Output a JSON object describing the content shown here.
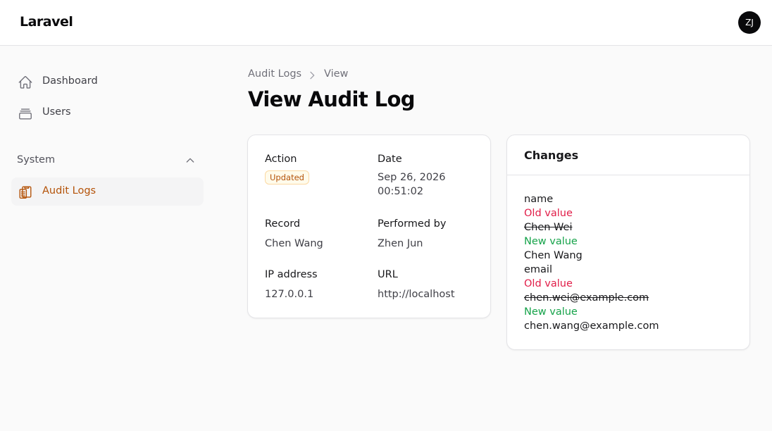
{
  "app": {
    "brand": "Laravel",
    "user_initials": "ZJ"
  },
  "sidebar": {
    "items": [
      {
        "label": "Dashboard",
        "icon": "home-icon"
      },
      {
        "label": "Users",
        "icon": "inbox-stack-icon"
      }
    ],
    "group": {
      "label": "System",
      "expanded": true,
      "items": [
        {
          "label": "Audit Logs",
          "icon": "clipboard-document-icon",
          "active": true
        }
      ]
    }
  },
  "breadcrumb": {
    "parent": "Audit Logs",
    "current": "View"
  },
  "page": {
    "title": "View Audit Log"
  },
  "details": {
    "action_label": "Action",
    "action_value": "Updated",
    "date_label": "Date",
    "date_line1": "Sep 26, 2026",
    "date_line2": "00:51:02",
    "record_label": "Record",
    "record_value": "Chen Wang",
    "performed_by_label": "Performed by",
    "performed_by_value": "Zhen Jun",
    "ip_label": "IP address",
    "ip_value": "127.0.0.1",
    "url_label": "URL",
    "url_value": "http://localhost"
  },
  "changes": {
    "title": "Changes",
    "entries": [
      {
        "field": "name",
        "old_label": "Old value",
        "old_value": "Chen Wei",
        "new_label": "New value",
        "new_value": "Chen Wang"
      },
      {
        "field": "email",
        "old_label": "Old value",
        "old_value": "chen.wei@example.com",
        "new_label": "New value",
        "new_value": "chen.wang@example.com"
      }
    ]
  },
  "colors": {
    "accent": "#b45309",
    "old_value": "#e11d48",
    "new_value": "#16a34a",
    "badge_bg": "#fffbeb"
  }
}
